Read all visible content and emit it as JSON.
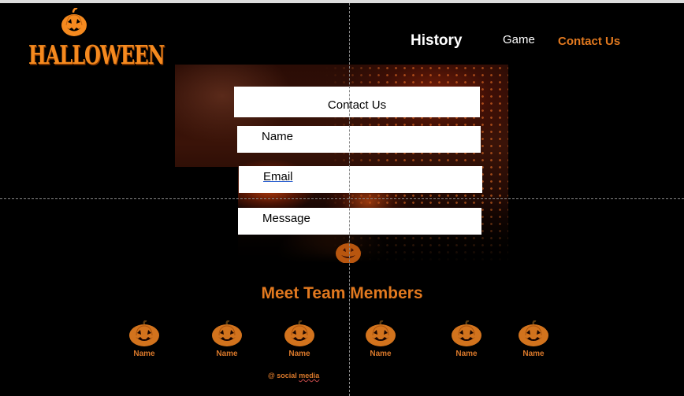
{
  "brand": {
    "logo_text": "HALLOWEEN"
  },
  "nav": {
    "items": [
      "History",
      "Game",
      "Contact Us"
    ]
  },
  "contact_form": {
    "title": "Contact Us",
    "fields": {
      "name": "Name",
      "email": "Email",
      "message": "Message"
    }
  },
  "team": {
    "title": "Meet Team Members",
    "members": [
      "Name",
      "Name",
      "Name",
      "Name",
      "Name",
      "Name"
    ]
  },
  "footer": {
    "social_prefix": "@ social ",
    "social_word": "media"
  },
  "colors": {
    "accent": "#e2791f",
    "background": "#000000",
    "text_light": "#ffffff"
  },
  "icons": {
    "member": "pumpkin-icon",
    "logo": "jack-o-lantern-icon"
  }
}
